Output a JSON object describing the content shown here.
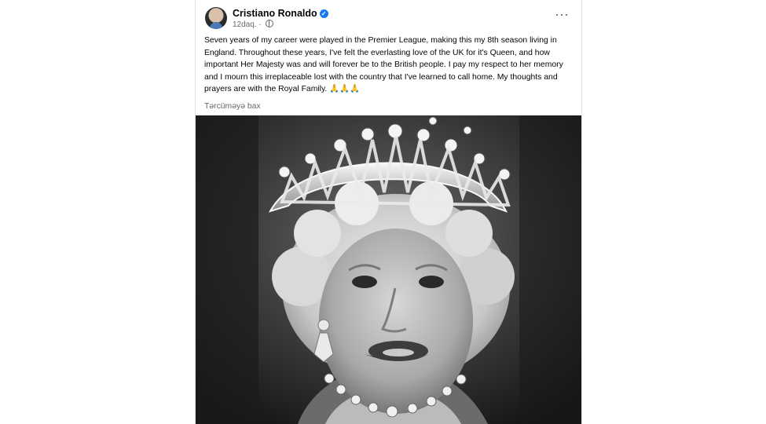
{
  "post": {
    "author": "Cristiano Ronaldo",
    "timestamp": "12daq.",
    "meta_separator": "·",
    "body": "Seven years of my career were played in the Premier League, making this my 8th season living in England. Throughout these years, I've felt the everlasting love of the UK for it's Queen, and how important Her Majesty was and will forever be to the British people. I pay my respect to her memory and I mourn this irreplaceable lost with the country that I've learned to call home. My thoughts and prayers are with the Royal Family. 🙏🙏🙏",
    "translate_label": "Tərcüməyə bax",
    "more_label": "···",
    "verified_mark": "✓"
  },
  "icons": {
    "verified": "verified-badge-icon",
    "audience": "globe-icon",
    "more": "more-horizontal-icon"
  },
  "colors": {
    "accent": "#1877f2",
    "secondary_text": "#65676b",
    "background": "#f0f2f5"
  }
}
